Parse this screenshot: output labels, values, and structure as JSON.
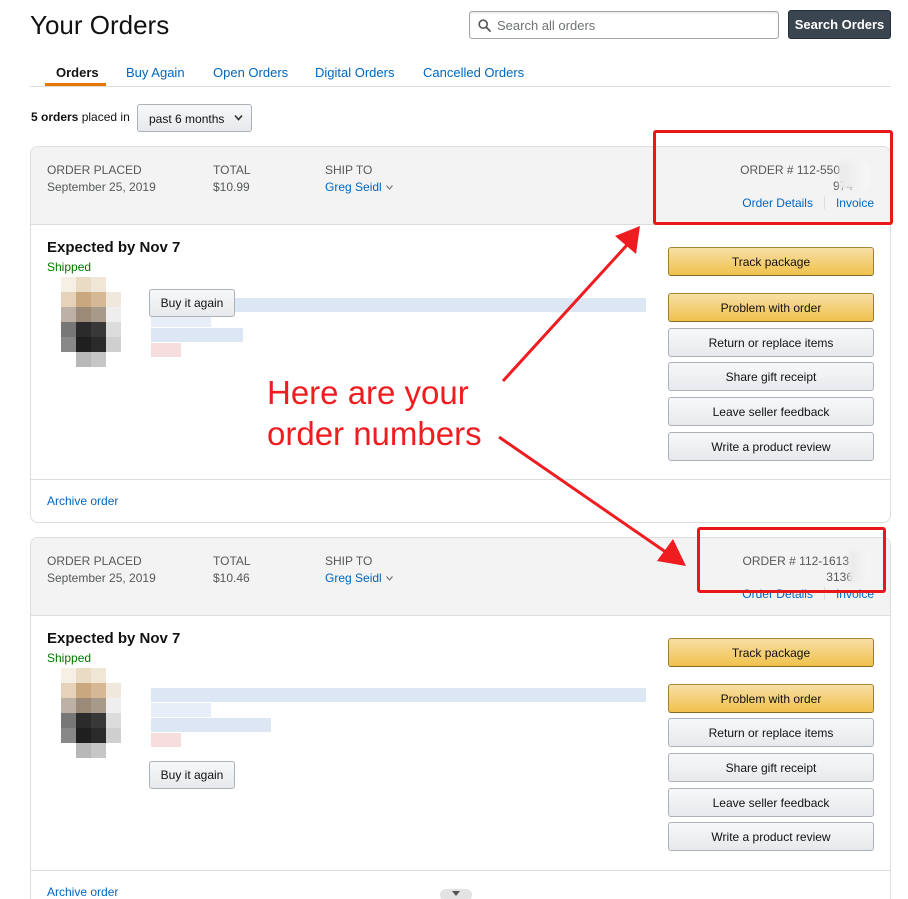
{
  "page": {
    "title": "Your Orders"
  },
  "search": {
    "placeholder": "Search all orders",
    "value": "",
    "button_label": "Search Orders"
  },
  "tabs": [
    {
      "label": "Orders",
      "active": true
    },
    {
      "label": "Buy Again",
      "active": false
    },
    {
      "label": "Open Orders",
      "active": false
    },
    {
      "label": "Digital Orders",
      "active": false
    },
    {
      "label": "Cancelled Orders",
      "active": false
    }
  ],
  "filter": {
    "count_text": "5 orders",
    "placed_in_text": "placed in",
    "selected": "past 6 months"
  },
  "headers": {
    "order_placed": "ORDER PLACED",
    "total": "TOTAL",
    "ship_to": "SHIP TO"
  },
  "orders": [
    {
      "date": "September 25, 2019",
      "total": "$10.99",
      "ship_to": "Greg Seidl",
      "order_number_line1": "ORDER # 112-550",
      "order_number_line2": "974",
      "order_details_label": "Order Details",
      "invoice_label": "Invoice",
      "expected": "Expected by Nov 7",
      "status": "Shipped",
      "buy_again_label": "Buy it again",
      "actions": [
        "Track package",
        "Problem with order",
        "Return or replace items",
        "Share gift receipt",
        "Leave seller feedback",
        "Write a product review"
      ],
      "archive_label": "Archive order"
    },
    {
      "date": "September 25, 2019",
      "total": "$10.46",
      "ship_to": "Greg Seidl",
      "order_number_line1": "ORDER # 112-1613",
      "order_number_line2": "3136",
      "order_details_label": "Order Details",
      "invoice_label": "Invoice",
      "expected": "Expected by Nov 7",
      "status": "Shipped",
      "buy_again_label": "Buy it again",
      "actions": [
        "Track package",
        "Problem with order",
        "Return or replace items",
        "Share gift receipt",
        "Leave seller feedback",
        "Write a product review"
      ],
      "archive_label": "Archive order"
    }
  ],
  "annotation": {
    "line1": "Here are your",
    "line2": "order numbers",
    "color": "#ef1c20"
  },
  "colors": {
    "link": "#0066c0",
    "accent": "#e77600",
    "shipped": "#007600",
    "primary_button": "#f0c14b"
  }
}
